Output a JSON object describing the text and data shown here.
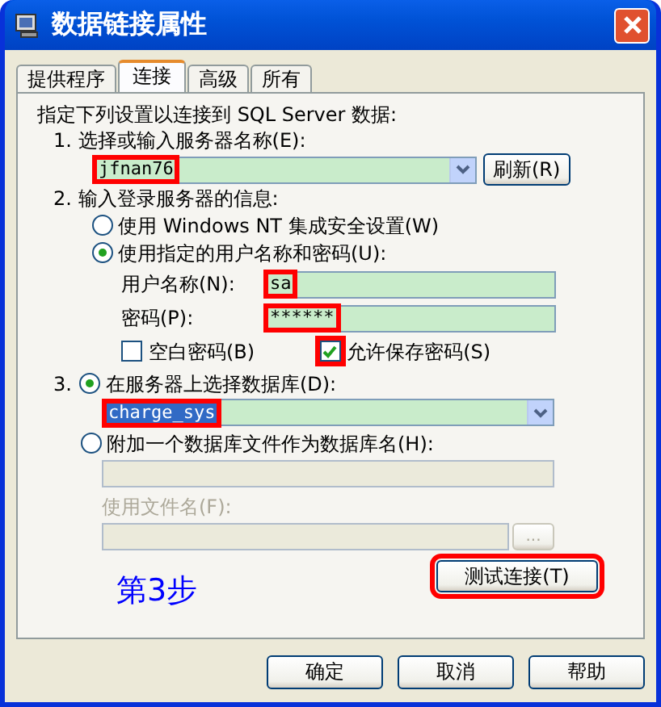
{
  "window": {
    "title": "数据链接属性"
  },
  "tabs": [
    {
      "label": "提供程序",
      "selected": false
    },
    {
      "label": "连接",
      "selected": true
    },
    {
      "label": "高级",
      "selected": false
    },
    {
      "label": "所有",
      "selected": false
    }
  ],
  "intro": "指定下列设置以连接到 SQL Server 数据:",
  "step1": {
    "label": "1. 选择或输入服务器名称(E):",
    "value": "jfnan76",
    "marked": true,
    "refresh_button": "刷新(R)"
  },
  "step2": {
    "label": "2. 输入登录服务器的信息:",
    "radios": [
      {
        "label": "使用 Windows NT 集成安全设置(W)",
        "selected": false
      },
      {
        "label": "使用指定的用户名称和密码(U):",
        "selected": true
      }
    ],
    "fields": [
      {
        "label": "用户名称(N):",
        "value": "sa",
        "marked": true
      },
      {
        "label": "密码(P):",
        "value": "******",
        "marked": true
      }
    ],
    "checkboxes": [
      {
        "label": "空白密码(B)",
        "checked": false,
        "marked": false
      },
      {
        "label": "允许保存密码(S)",
        "checked": true,
        "marked": true
      }
    ]
  },
  "step3": {
    "number": "3.",
    "radios": [
      {
        "label": "在服务器上选择数据库(D):",
        "selected": true
      },
      {
        "label": "附加一个数据库文件作为数据库名(H):",
        "selected": false
      }
    ],
    "database": {
      "value": "charge_sys",
      "marked": true
    },
    "file_label": "使用文件名(F):",
    "browse_button": "...",
    "disabled": true
  },
  "annotation": "第3步",
  "test_button": {
    "label": "测试连接(T)",
    "marked": true
  },
  "buttons": [
    "确定",
    "取消",
    "帮助"
  ]
}
